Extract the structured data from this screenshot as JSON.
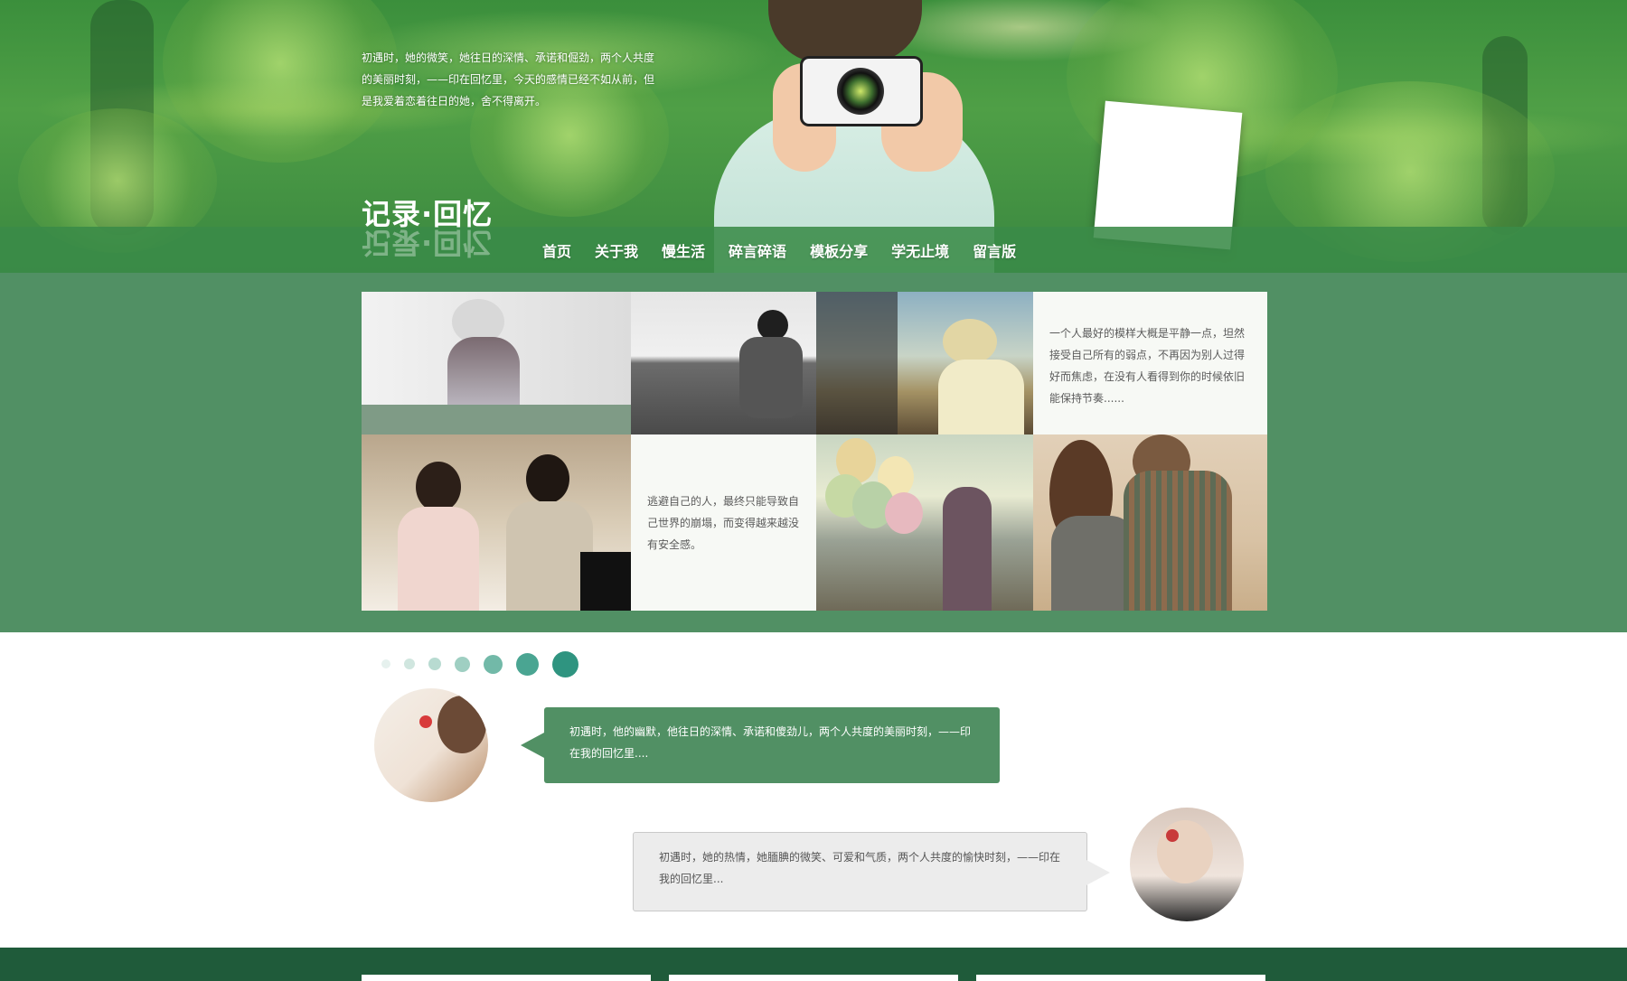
{
  "header": {
    "intro_text": "初遇时，她的微笑，她往日的深情、承诺和倔劲，两个人共度的美丽时刻，——印在回忆里，今天的感情已经不如从前，但是我爱着恋着往日的她，舍不得离开。",
    "site_title": "记录·回忆"
  },
  "nav": {
    "items": [
      "首页",
      "关于我",
      "慢生活",
      "碎言碎语",
      "模板分享",
      "学无止境",
      "留言版"
    ]
  },
  "gallery": {
    "quote_1": "一个人最好的模样大概是平静一点，坦然接受自己所有的弱点，不再因为别人过得好而焦虑，在没有人看得到你的时候依旧能保持节奏......",
    "quote_2": "逃避自己的人，最终只能导致自己世界的崩塌，而变得越来越没有安全感。"
  },
  "comments": [
    {
      "text": "初遇时，他的幽默，他往日的深情、承诺和傻劲儿，两个人共度的美丽时刻，——印在我的回忆里...."
    },
    {
      "text": "初遇时，她的热情，她腼腆的微笑、可爱和气质，两个人共度的愉快时刻，——印在我的回忆里..."
    }
  ],
  "colors": {
    "brand_green": "#519064",
    "nav_green": "#3a8b48",
    "footer_green": "#1f5b3a",
    "dot_teal": "#2f9480"
  }
}
